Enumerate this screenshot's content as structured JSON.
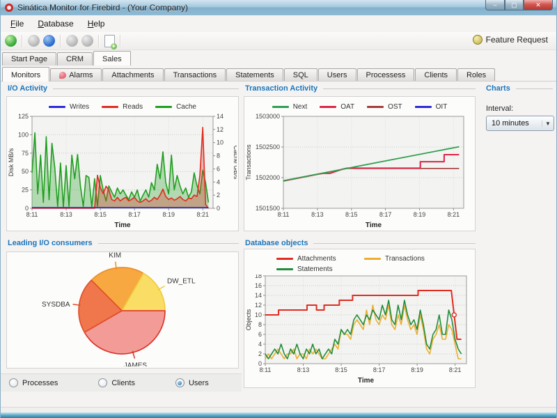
{
  "colors": {
    "section_accent": "#1b75bb",
    "titlebar": "#8fbad4",
    "close_red": "#c23b35"
  },
  "window": {
    "title": "Sinática Monitor for Firebird - (Your Company)"
  },
  "window_controls": {
    "minimize": "–",
    "maximize": "▢",
    "close": "✕"
  },
  "menu": {
    "items": [
      {
        "label": "File"
      },
      {
        "label": "Database"
      },
      {
        "label": "Help"
      }
    ]
  },
  "toolbar": {
    "feature_request_label": "Feature Request"
  },
  "tabs_main": [
    {
      "label": "Start Page"
    },
    {
      "label": "CRM"
    },
    {
      "label": "Sales"
    }
  ],
  "tabs_monitor": [
    {
      "label": "Monitors"
    },
    {
      "label": "Alarms"
    },
    {
      "label": "Attachments"
    },
    {
      "label": "Transactions"
    },
    {
      "label": "Statements"
    },
    {
      "label": "SQL"
    },
    {
      "label": "Users"
    },
    {
      "label": "Processess"
    },
    {
      "label": "Clients"
    },
    {
      "label": "Roles"
    }
  ],
  "sections": {
    "io": "I/O Activity",
    "tx": "Transaction Activity",
    "pie": "Leading I/O consumers",
    "db": "Database objects",
    "charts": "Charts"
  },
  "sidebar": {
    "interval_label": "Interval:",
    "interval_value": "10 minutes",
    "dropdown_arrow": "▼"
  },
  "radios": [
    {
      "label": "Processes",
      "selected": false
    },
    {
      "label": "Clients",
      "selected": false
    },
    {
      "label": "Users",
      "selected": true
    }
  ],
  "chart_data": [
    {
      "id": "io_activity",
      "type": "area-line",
      "title": "I/O Activity",
      "xlabel": "Time",
      "x_range": [
        0,
        10.6
      ],
      "x_ticks": [
        0,
        2,
        4,
        6,
        8,
        10
      ],
      "x_tick_labels": [
        "8:11",
        "8:13",
        "8:15",
        "8:17",
        "8:19",
        "8:21"
      ],
      "y_left": {
        "label": "Disk MB/s",
        "range": [
          0,
          125
        ],
        "ticks": [
          0,
          25,
          50,
          75,
          100,
          125
        ]
      },
      "y_right": {
        "label": "Cache GB/s",
        "range": [
          0,
          14
        ],
        "ticks": [
          0,
          2,
          4,
          6,
          8,
          10,
          12,
          14
        ]
      },
      "draw_order": [
        2,
        1,
        0
      ],
      "series": [
        {
          "name": "Writes",
          "color": "#2b2bd6",
          "axis": "left",
          "x": [
            0,
            10.33
          ],
          "y": [
            1,
            1
          ],
          "width": 1.6
        },
        {
          "name": "Reads",
          "color": "#e02b20",
          "axis": "left",
          "fill": true,
          "x_span": [
            0,
            10.33
          ],
          "width": 1.6,
          "y": [
            0,
            0,
            0,
            0,
            0,
            0,
            0,
            0,
            0,
            0,
            0,
            0,
            0,
            0,
            0,
            0,
            0,
            0,
            0,
            0,
            0,
            0,
            0,
            45,
            28,
            20,
            30,
            25,
            12,
            10,
            15,
            10,
            13,
            15,
            10,
            12,
            15,
            10,
            8,
            10,
            13,
            9,
            11,
            15,
            12,
            18,
            26,
            16,
            12,
            14,
            11,
            13,
            16,
            12,
            10,
            14,
            13,
            18,
            16,
            45,
            110,
            5,
            0
          ]
        },
        {
          "name": "Cache",
          "color": "#1f9e1f",
          "axis": "right",
          "fill": true,
          "x_span": [
            0,
            10.33
          ],
          "width": 1.6,
          "y": [
            5.4,
            11.5,
            2.2,
            8.1,
            0.9,
            10.9,
            1.3,
            9.9,
            6.2,
            0.3,
            6.9,
            0.2,
            6.5,
            0.3,
            8.1,
            4.5,
            8.2,
            3.4,
            0.3,
            5,
            4.7,
            0.2,
            4.5,
            0.3,
            5,
            2.8,
            1.1,
            3.4,
            2.5,
            1.7,
            3.1,
            2.2,
            2.8,
            2,
            1.3,
            2.5,
            1.7,
            2.8,
            1.1,
            2,
            2.8,
            1.7,
            3.9,
            2.8,
            6.7,
            4.5,
            8.6,
            3.9,
            2.2,
            8.1,
            2.8,
            5,
            3.4,
            2.2,
            3.1,
            1.7,
            2.5,
            5.4,
            3.4,
            2.2,
            5.8,
            3.9,
            0.9
          ]
        }
      ]
    },
    {
      "id": "transaction_activity",
      "type": "line",
      "title": "Transaction Activity",
      "xlabel": "Time",
      "x_range": [
        0,
        10.6
      ],
      "x_ticks": [
        0,
        2,
        4,
        6,
        8,
        10
      ],
      "x_tick_labels": [
        "8:11",
        "8:13",
        "8:15",
        "8:17",
        "8:19",
        "8:21"
      ],
      "y_left": {
        "label": "Transactions",
        "range": [
          1501500,
          1503000
        ],
        "ticks": [
          1501500,
          1502000,
          1502500,
          1503000
        ]
      },
      "draw_order": [
        3,
        2,
        1,
        0
      ],
      "series": [
        {
          "name": "Next",
          "color": "#2e9e4f",
          "axis": "left",
          "width": 1.8,
          "x": [
            0,
            5.2,
            10.33
          ],
          "y": [
            1501950,
            1502230,
            1502505
          ]
        },
        {
          "name": "OAT",
          "color": "#db2445",
          "axis": "left",
          "width": 2,
          "x": [
            0,
            1.0,
            2.0,
            2.35,
            2.75,
            3.1,
            3.5,
            3.75,
            8.05,
            8.05,
            9.45,
            9.45,
            10.33
          ],
          "y": [
            1501945,
            1502000,
            1502055,
            1502070,
            1502070,
            1502105,
            1502140,
            1502155,
            1502155,
            1502260,
            1502260,
            1502375,
            1502375
          ]
        },
        {
          "name": "OST",
          "color": "#a33b3b",
          "axis": "left",
          "width": 1.6,
          "x": [
            0,
            1.0,
            2.0,
            2.35,
            2.75,
            3.1,
            3.5,
            3.75,
            10.33
          ],
          "y": [
            1501945,
            1502000,
            1502055,
            1502070,
            1502070,
            1502105,
            1502140,
            1502150,
            1502150
          ]
        },
        {
          "name": "OIT",
          "color": "#2b2bd6",
          "axis": "left",
          "width": 1.6,
          "y": []
        }
      ]
    },
    {
      "id": "leading_io_consumers",
      "type": "pie",
      "title": "Leading I/O consumers",
      "slices": [
        {
          "label": "KIM",
          "start_deg": 315,
          "end_deg": 390,
          "color": "#F7A841",
          "stroke": "#ED8B26"
        },
        {
          "label": "DW_ETL",
          "start_deg": 30,
          "end_deg": 90,
          "color": "#FADD64",
          "stroke": "#EFC93B"
        },
        {
          "label": "JAMES",
          "start_deg": 90,
          "end_deg": 240,
          "color": "#F29B97",
          "stroke": "#D93025"
        },
        {
          "label": "SYSDBA",
          "start_deg": 240,
          "end_deg": 315,
          "color": "#F0764B",
          "stroke": "#E04E28"
        }
      ]
    },
    {
      "id": "database_objects",
      "type": "line",
      "title": "Database objects",
      "xlabel": "Time",
      "x_range": [
        0,
        10.6
      ],
      "x_ticks": [
        0,
        2,
        4,
        6,
        8,
        10
      ],
      "x_tick_labels": [
        "8:11",
        "8:13",
        "8:15",
        "8:17",
        "8:19",
        "8:21"
      ],
      "y_left": {
        "label": "Objects",
        "range": [
          0,
          18
        ],
        "ticks": [
          0,
          2,
          4,
          6,
          8,
          10,
          12,
          14,
          16,
          18
        ]
      },
      "draw_order": [
        1,
        2,
        0
      ],
      "series": [
        {
          "name": "Attachments",
          "color": "#e02b20",
          "axis": "left",
          "width": 2,
          "x": [
            0,
            0.7,
            0.7,
            2.2,
            2.2,
            2.7,
            2.7,
            3.1,
            3.1,
            3.9,
            3.9,
            4.6,
            4.6,
            8.05,
            8.05,
            9.8,
            9.8,
            9.95,
            10.1,
            10.33
          ],
          "y": [
            10,
            10,
            11,
            11,
            12,
            12,
            11,
            11,
            12,
            12,
            13,
            13,
            14,
            14,
            15,
            15,
            15,
            10,
            5,
            5
          ],
          "marker": {
            "x": 9.95,
            "y": 10
          }
        },
        {
          "name": "Transactions",
          "color": "#ecae2c",
          "axis": "left",
          "width": 1.6,
          "x_span": [
            0,
            10.33
          ],
          "y": [
            1,
            2,
            1,
            2,
            3,
            2,
            1,
            2,
            2,
            3,
            1,
            2,
            2,
            1,
            3,
            2,
            3,
            2,
            1,
            1,
            2,
            3,
            4,
            3,
            7,
            6,
            6,
            5,
            8,
            9,
            8,
            7,
            11,
            8,
            12,
            9,
            8,
            10,
            9,
            12,
            8,
            7,
            10,
            8,
            12,
            9,
            7,
            8,
            6,
            10,
            7,
            3,
            2,
            5,
            6,
            8,
            5,
            5,
            8,
            7,
            4,
            1,
            1
          ]
        },
        {
          "name": "Statements",
          "color": "#1f8c3a",
          "axis": "left",
          "width": 1.6,
          "x_span": [
            0,
            10.33
          ],
          "y": [
            2,
            1,
            2,
            3,
            2,
            4,
            2,
            1,
            3,
            2,
            4,
            2,
            1,
            3,
            2,
            4,
            2,
            3,
            1,
            2,
            3,
            2,
            5,
            4,
            7,
            6,
            7,
            6,
            9,
            10,
            9,
            8,
            10,
            9,
            11,
            10,
            9,
            12,
            10,
            13,
            9,
            8,
            12,
            9,
            13,
            10,
            8,
            9,
            7,
            11,
            8,
            4,
            3,
            6,
            7,
            10,
            6,
            6,
            11,
            9,
            5,
            3,
            2
          ]
        }
      ]
    }
  ]
}
